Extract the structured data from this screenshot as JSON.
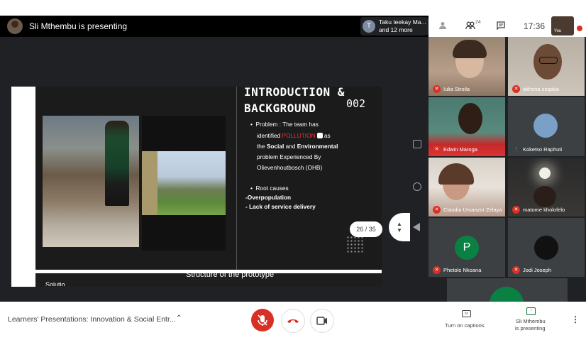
{
  "top_bar": {
    "presenting_title": "Sli Mthembu is presenting",
    "viewers_initial": "T",
    "viewers_line1": "Taku teekay Ma...",
    "viewers_line2": "and 12 more",
    "people_count": "24",
    "clock": "17:36",
    "self_label": "You"
  },
  "slide": {
    "title_line1": "INTRODUCTION &",
    "title_line2": "BACKGROUND",
    "number": "002",
    "bullet1_prefix": "Problem : The team has",
    "line2_pre": "identified ",
    "line2_highlight": "POLLUTION",
    "line2_post": " as",
    "line3_pre": "the ",
    "line3_bold1": "Social",
    "line3_mid": " and ",
    "line3_bold2": "Environmental",
    "line4": "problem Experienced By",
    "line5": "Olievenhoutbosch (OHB)",
    "bullet2": "Root causes",
    "cause1": "-Overpopulation",
    "cause2": "- Lack of service delivery",
    "next_slide_text": "Structure of the prototype",
    "next_left_text": "Solutio..."
  },
  "page_counter": "26 / 35",
  "participants": [
    {
      "name": "Iulia Stroila"
    },
    {
      "name": "akhona soqaka"
    },
    {
      "name": "Edwin Maroga"
    },
    {
      "name": "Koketso Raphuti"
    },
    {
      "name": "Claudia Umanzor Zelaya"
    },
    {
      "name": "matome kholofelo"
    },
    {
      "name": "Phetolo Nkoana",
      "initial": "P"
    },
    {
      "name": "Jodi Joseph"
    }
  ],
  "bottom_bar": {
    "meeting_title": "Learners' Presentations: Innovation & Social Entr...",
    "captions_label": "Turn on captions",
    "present_label_line1": "Sli Mthembu",
    "present_label_line2": "is presenting",
    "captions_icon_text": "cc"
  },
  "colors": {
    "danger": "#d93025",
    "pollution_highlight": "#e8333a",
    "present_green": "#137333",
    "avatar_green": "#0b8043"
  },
  "icons": {
    "people": "people-icon",
    "chat": "chat-icon",
    "person": "person-icon",
    "mic_off": "mic-off-icon",
    "hangup": "hangup-icon",
    "camera": "camera-icon",
    "captions": "captions-icon",
    "present": "present-icon",
    "more": "more-vert-icon"
  }
}
